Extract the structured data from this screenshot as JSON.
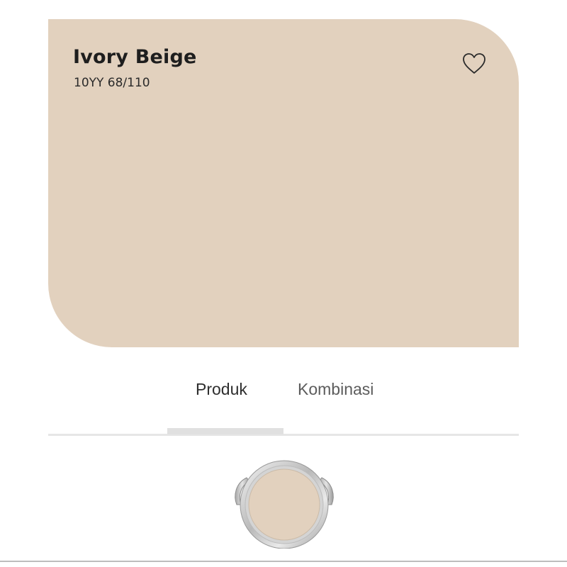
{
  "swatch": {
    "name": "Ivory Beige",
    "code": "10YY 68/110",
    "color": "#e2d1be"
  },
  "favorite": {
    "icon": "heart-outline-icon"
  },
  "tabs": [
    {
      "label": "Produk",
      "active": true
    },
    {
      "label": "Kombinasi",
      "active": false
    }
  ],
  "product": {
    "icon": "paint-can-icon",
    "lid_color": "#e2d1be"
  }
}
